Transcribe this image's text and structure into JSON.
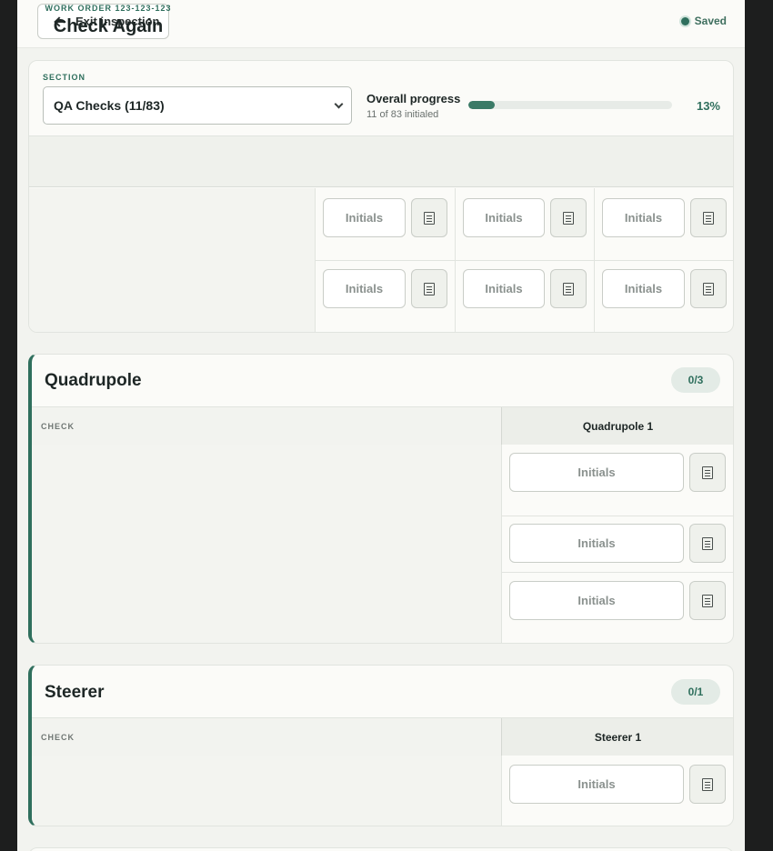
{
  "header": {
    "exit_label": "Exit inspection",
    "work_order": "WORK ORDER 123-123-123",
    "title": "Check Again",
    "status": "Saved"
  },
  "section": {
    "label": "SECTION",
    "selected": "QA Checks (11/83)"
  },
  "progress": {
    "title": "Overall progress",
    "subtitle": "11 of 83 initialed",
    "percent_label": "13%",
    "fraction": 0.13
  },
  "initials_placeholder": "Initials",
  "groups": [
    {
      "title": "Quadrupole",
      "badge": "0/3",
      "check_header": "CHECK",
      "columns": [
        "Quadrupole 1"
      ]
    },
    {
      "title": "Steerer",
      "badge": "0/1",
      "check_header": "CHECK",
      "columns": [
        "Steerer 1"
      ]
    }
  ],
  "icons": {
    "back": "arrow-left-icon",
    "note": "note-icon",
    "dropdown": "chevron-down-icon",
    "saved": "status-dot-icon"
  },
  "colors": {
    "accent": "#2f6f5d",
    "background": "#f2f3ef",
    "card": "#fbfbf8"
  }
}
